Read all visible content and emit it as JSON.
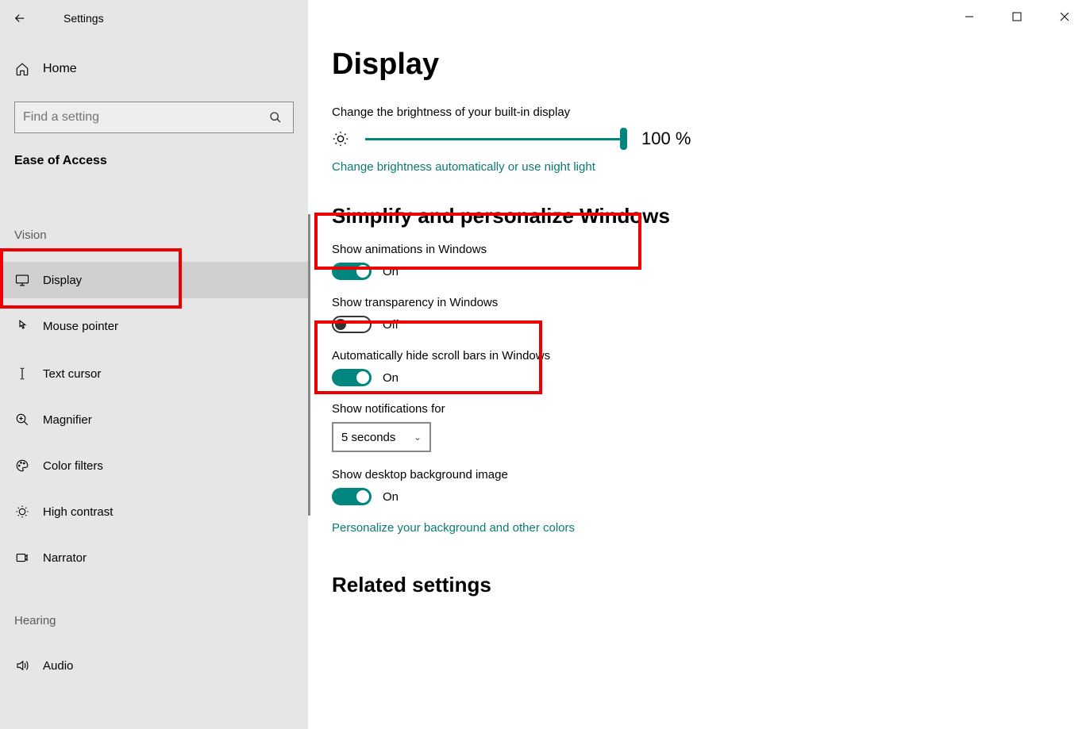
{
  "app": {
    "title": "Settings"
  },
  "sidebar": {
    "home": "Home",
    "search_placeholder": "Find a setting",
    "category": "Ease of Access",
    "groups": {
      "vision": "Vision",
      "hearing": "Hearing"
    },
    "items": {
      "display": "Display",
      "mouse": "Mouse pointer",
      "cursor": "Text cursor",
      "magnifier": "Magnifier",
      "color": "Color filters",
      "contrast": "High contrast",
      "narrator": "Narrator",
      "audio": "Audio"
    }
  },
  "main": {
    "title": "Display",
    "brightness": {
      "label": "Change the brightness of your built-in display",
      "value": "100 %",
      "link": "Change brightness automatically or use night light"
    },
    "section_simplify": "Simplify and personalize Windows",
    "settings": {
      "animations": {
        "label": "Show animations in Windows",
        "state": "On"
      },
      "transparency": {
        "label": "Show transparency in Windows",
        "state": "Off"
      },
      "scrollbars": {
        "label": "Automatically hide scroll bars in Windows",
        "state": "On"
      },
      "notifications": {
        "label": "Show notifications for",
        "value": "5 seconds"
      },
      "background": {
        "label": "Show desktop background image",
        "state": "On"
      }
    },
    "personalize_link": "Personalize your background and other colors",
    "related": "Related settings"
  }
}
